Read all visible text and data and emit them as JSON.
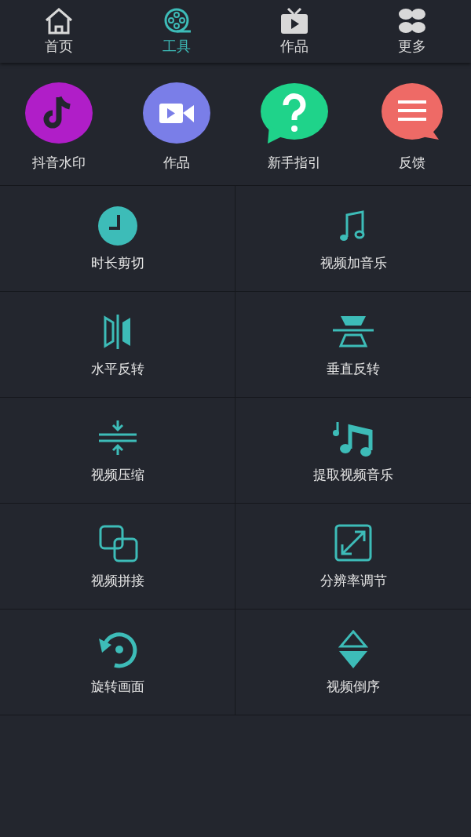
{
  "tabs": [
    {
      "label": "首页",
      "kind": "home",
      "selected": false
    },
    {
      "label": "工具",
      "kind": "film",
      "selected": true
    },
    {
      "label": "作品",
      "kind": "tv",
      "selected": false
    },
    {
      "label": "更多",
      "kind": "clover",
      "selected": false
    }
  ],
  "shortcuts": [
    {
      "label": "抖音水印",
      "kind": "note",
      "color": "#b01ec8"
    },
    {
      "label": "作品",
      "kind": "camera",
      "color": "#7a7ee8"
    },
    {
      "label": "新手指引",
      "kind": "question",
      "color": "#1fd38a"
    },
    {
      "label": "反馈",
      "kind": "lines",
      "color": "#ee6a66"
    }
  ],
  "tools": [
    {
      "label": "时长剪切",
      "kind": "clock"
    },
    {
      "label": "视频加音乐",
      "kind": "notes"
    },
    {
      "label": "水平反转",
      "kind": "flip-h"
    },
    {
      "label": "垂直反转",
      "kind": "flip-v"
    },
    {
      "label": "视频压缩",
      "kind": "compress"
    },
    {
      "label": "提取视频音乐",
      "kind": "music"
    },
    {
      "label": "视频拼接",
      "kind": "merge"
    },
    {
      "label": "分辨率调节",
      "kind": "resize"
    },
    {
      "label": "旋转画面",
      "kind": "rotate"
    },
    {
      "label": "视频倒序",
      "kind": "reverse"
    }
  ]
}
